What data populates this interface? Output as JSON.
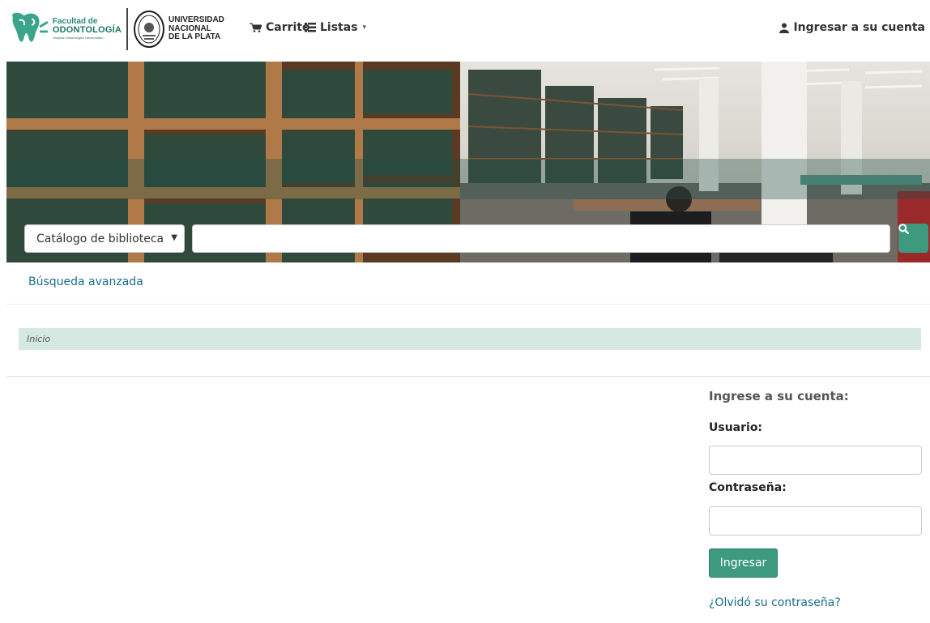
{
  "header": {
    "faculty_logo": {
      "line1": "Facultad de",
      "line2": "ODONTOLOGÍA",
      "line3": "Hospital Odontológico Universitario"
    },
    "university_logo": {
      "line1": "UNIVERSIDAD",
      "line2": "NACIONAL",
      "line3": "DE LA PLATA"
    },
    "nav": {
      "cart_label": "Carrito",
      "lists_label": "Listas",
      "login_label": "Ingresar a su cuenta"
    }
  },
  "search": {
    "scope_selected": "Catálogo de biblioteca",
    "query_value": "",
    "submit_icon": "search-icon"
  },
  "advanced_search_label": "Búsqueda avanzada",
  "breadcrumb": {
    "home_label": "Inicio"
  },
  "login": {
    "title": "Ingrese a su cuenta:",
    "user_label": "Usuario:",
    "user_value": "",
    "password_label": "Contraseña:",
    "password_value": "",
    "submit_label": "Ingresar",
    "forgot_label": "¿Olvidó su contraseña?"
  },
  "colors": {
    "accent": "#3d9a7f",
    "link": "#1a6c8c",
    "breadcrumb_bg": "#d5e9e2"
  }
}
